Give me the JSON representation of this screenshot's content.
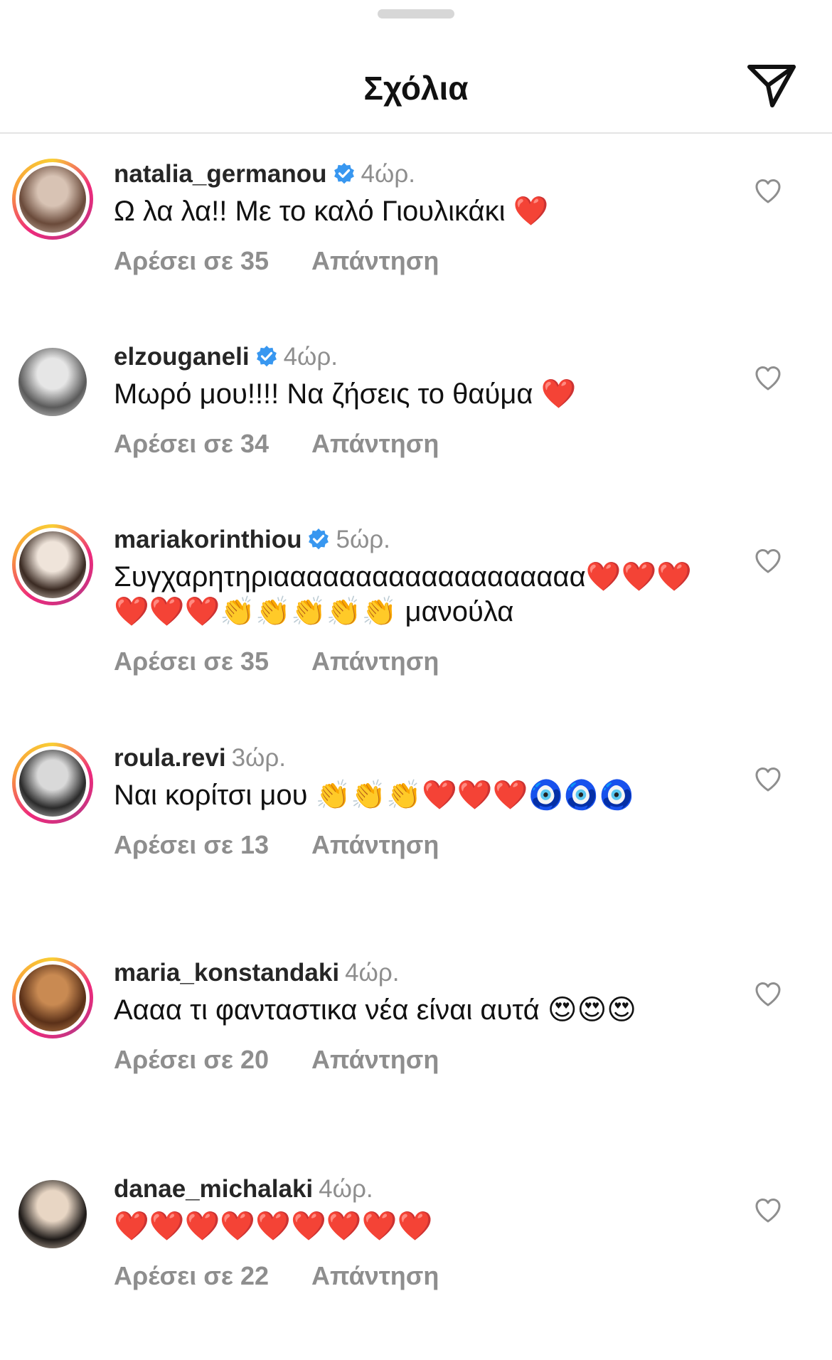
{
  "header": {
    "title": "Σχόλια"
  },
  "comments": [
    {
      "username": "natalia_germanou",
      "verified": true,
      "time": "4ώρ.",
      "text": "Ω λα λα!! Με το καλό Γιουλικάκι ❤️",
      "likes": "Αρέσει σε 35",
      "reply": "Απάντηση",
      "ring": true,
      "avatar_colors": [
        "#d8c3b4",
        "#6a4a3a"
      ]
    },
    {
      "username": "elzouganeli",
      "verified": true,
      "time": "4ώρ.",
      "text": "Μωρό μου!!!! Να ζήσεις το θαύμα ❤️",
      "likes": "Αρέσει σε 34",
      "reply": "Απάντηση",
      "ring": false,
      "avatar_colors": [
        "#e6e6e6",
        "#5a5a5a"
      ]
    },
    {
      "username": "mariakorinthiou",
      "verified": true,
      "time": "5ώρ.",
      "text": "Συγχαρητηριααααααααααααααααααα❤️❤️❤️❤️❤️❤️👏👏👏👏👏 μανούλα",
      "likes": "Αρέσει σε 35",
      "reply": "Απάντηση",
      "ring": true,
      "avatar_colors": [
        "#efe4da",
        "#3a2a22"
      ]
    },
    {
      "username": "roula.revi",
      "verified": false,
      "time": "3ώρ.",
      "text": "Ναι κορίτσι μου 👏👏👏❤️❤️❤️🧿🧿🧿",
      "likes": "Αρέσει σε 13",
      "reply": "Απάντηση",
      "ring": true,
      "avatar_colors": [
        "#d9d9d9",
        "#2a2a2a"
      ]
    },
    {
      "username": "maria_konstandaki",
      "verified": false,
      "time": "4ώρ.",
      "text": "Αααα τι φανταστικα νέα είναι αυτά 😍😍😍",
      "likes": "Αρέσει σε 20",
      "reply": "Απάντηση",
      "ring": true,
      "avatar_colors": [
        "#c98a52",
        "#5a3018"
      ]
    },
    {
      "username": "danae_michalaki",
      "verified": false,
      "time": "4ώρ.",
      "text": "❤️❤️❤️❤️❤️❤️❤️❤️❤️",
      "likes": "Αρέσει σε 22",
      "reply": "Απάντηση",
      "ring": false,
      "avatar_colors": [
        "#e8d6c4",
        "#1e1a18"
      ]
    }
  ],
  "colors": {
    "verified_blue": "#3897f0",
    "muted_text": "#8e8e8e"
  },
  "icons": {
    "send": "paper-plane-icon",
    "like": "heart-outline-icon",
    "verified": "verified-badge-icon"
  }
}
